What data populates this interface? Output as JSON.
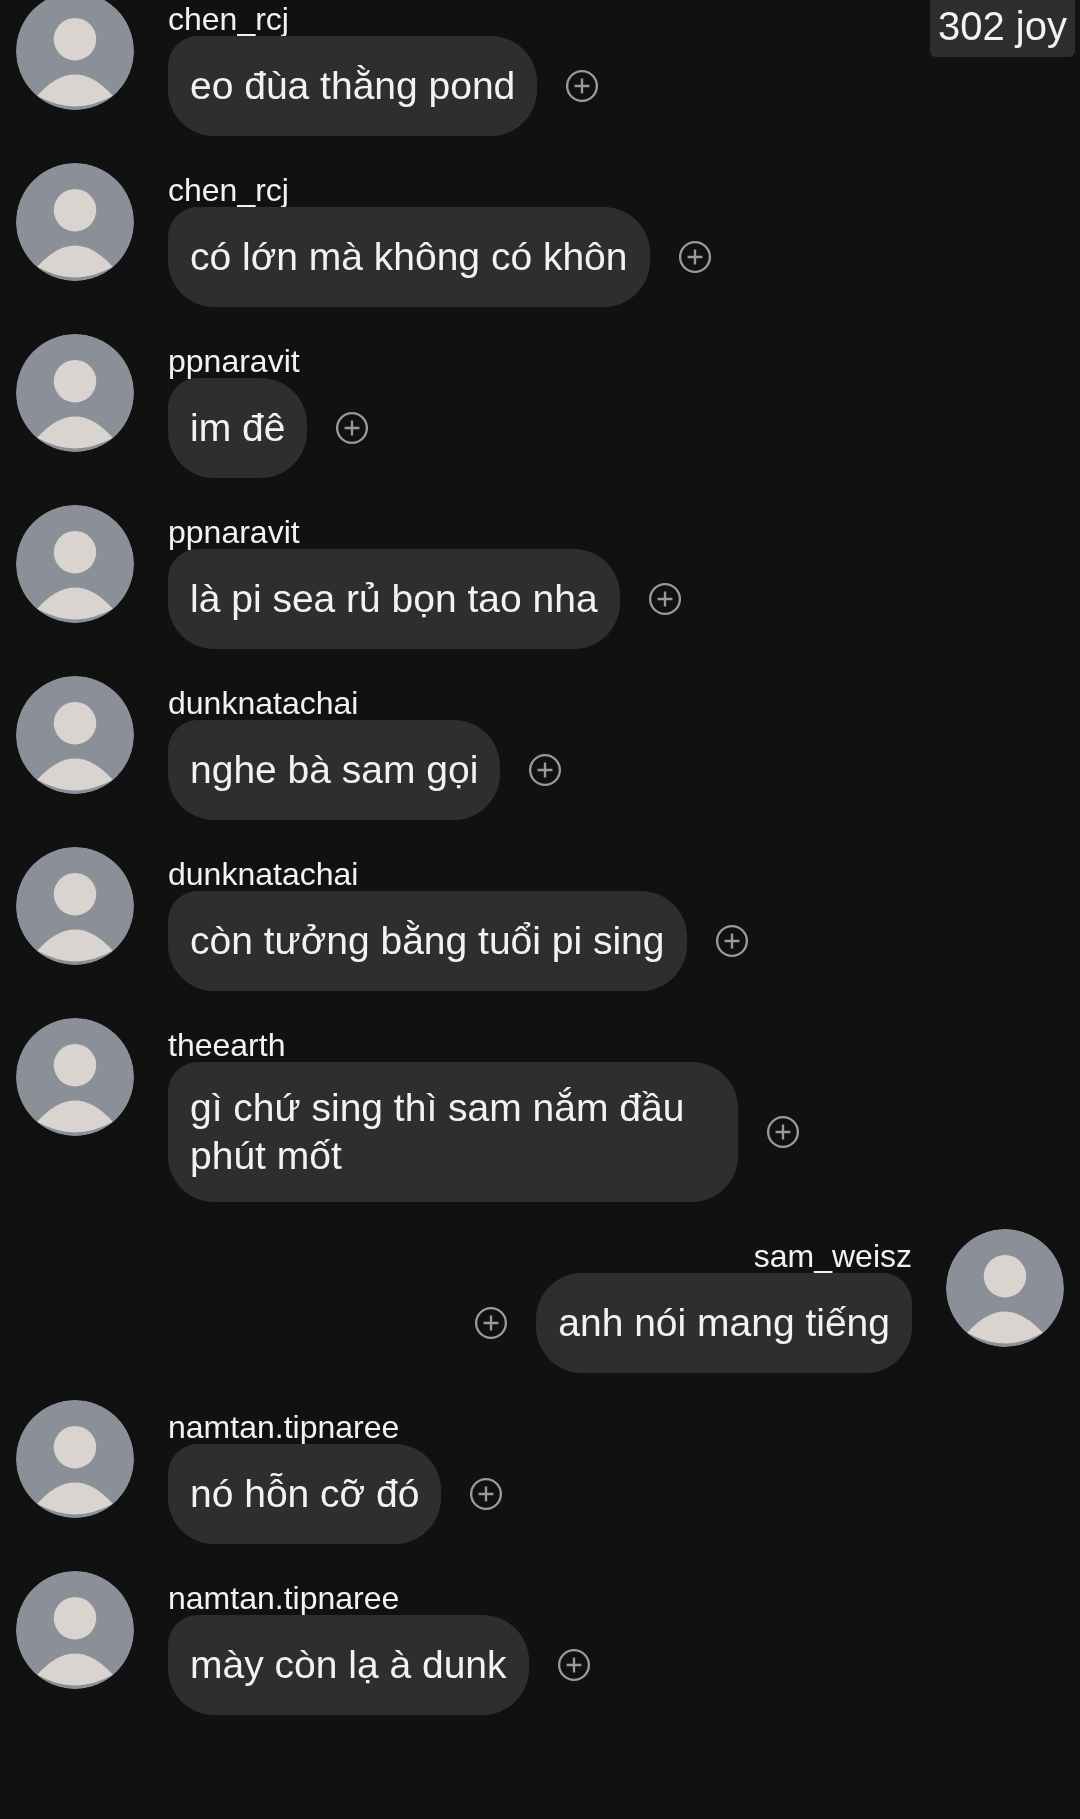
{
  "badge": "302 joy",
  "messages": [
    {
      "kind": "incoming",
      "sender": "chen_rcj",
      "text": "eo đùa thằng pond"
    },
    {
      "kind": "incoming",
      "sender": "chen_rcj",
      "text": "có lớn mà không có khôn"
    },
    {
      "kind": "incoming",
      "sender": "ppnaravit",
      "text": "im đê"
    },
    {
      "kind": "incoming",
      "sender": "ppnaravit",
      "text": "là pi sea rủ bọn tao nha"
    },
    {
      "kind": "incoming",
      "sender": "dunknatachai",
      "text": "nghe bà sam gọi"
    },
    {
      "kind": "incoming",
      "sender": "dunknatachai",
      "text": "còn tưởng bằng tuổi pi sing"
    },
    {
      "kind": "incoming",
      "sender": "theearth",
      "text": "gì chứ sing thì sam nắm đầu phút mốt"
    },
    {
      "kind": "outgoing",
      "sender": "sam_weisz",
      "text": "anh nói mang tiếng"
    },
    {
      "kind": "incoming",
      "sender": "namtan.tipnaree",
      "text": "nó hỗn cỡ đó"
    },
    {
      "kind": "incoming",
      "sender": "namtan.tipnaree",
      "text": "mày còn lạ à dunk"
    }
  ]
}
